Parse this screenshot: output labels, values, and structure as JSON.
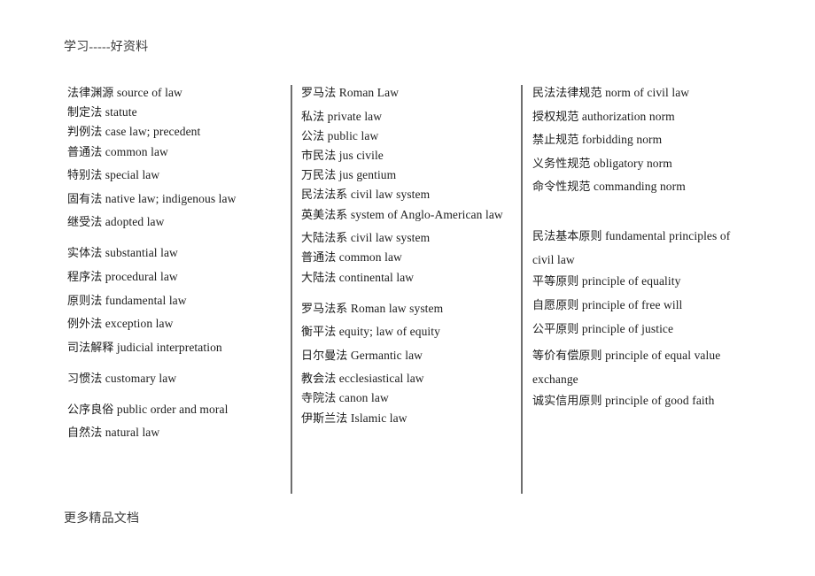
{
  "document": {
    "header": "学习-----好资料",
    "footer": "更多精品文档"
  },
  "columns": [
    {
      "id": "column-1",
      "entries": [
        {
          "cn": "法律渊源",
          "en": "source of law",
          "spacing": "tight"
        },
        {
          "cn": "制定法",
          "en": "statute",
          "spacing": "tight"
        },
        {
          "cn": "判例法",
          "en": "case law; precedent",
          "spacing": "tight"
        },
        {
          "cn": "普通法",
          "en": "common law",
          "spacing": "normal"
        },
        {
          "cn": "特别法",
          "en": "special law",
          "spacing": "normal"
        },
        {
          "cn": "固有法",
          "en": "native law; indigenous law",
          "spacing": "normal"
        },
        {
          "cn": "继受法",
          "en": "adopted law",
          "spacing": "gap"
        },
        {
          "cn": "实体法",
          "en": "substantial law",
          "spacing": "normal"
        },
        {
          "cn": "程序法",
          "en": "procedural law",
          "spacing": "normal"
        },
        {
          "cn": "原则法",
          "en": "fundamental law",
          "spacing": "normal"
        },
        {
          "cn": "例外法",
          "en": "exception law",
          "spacing": "normal"
        },
        {
          "cn": "司法解释",
          "en": "judicial interpretation",
          "spacing": "gap"
        },
        {
          "cn": "习惯法",
          "en": "customary law",
          "spacing": "gap"
        },
        {
          "cn": "公序良俗",
          "en": "public order and moral",
          "spacing": "normal"
        },
        {
          "cn": "自然法",
          "en": "natural law",
          "spacing": "normal"
        }
      ]
    },
    {
      "id": "column-2",
      "entries": [
        {
          "cn": "罗马法",
          "en": "Roman Law",
          "spacing": "normal"
        },
        {
          "cn": "私法",
          "en": "private law",
          "spacing": "tight"
        },
        {
          "cn": "公法",
          "en": "public law",
          "spacing": "tight"
        },
        {
          "cn": "市民法",
          "en": "jus civile",
          "spacing": "tight"
        },
        {
          "cn": "万民法",
          "en": "jus gentium",
          "spacing": "tight"
        },
        {
          "cn": "民法法系",
          "en": "civil law system",
          "spacing": "tight"
        },
        {
          "cn": "英美法系",
          "en": "system of Anglo-American law",
          "spacing": "normal"
        },
        {
          "cn": "大陆法系",
          "en": "civil law system",
          "spacing": "tight"
        },
        {
          "cn": "普通法",
          "en": "common law",
          "spacing": "tight"
        },
        {
          "cn": "大陆法",
          "en": "continental law",
          "spacing": "gap"
        },
        {
          "cn": "罗马法系",
          "en": "Roman law system",
          "spacing": "normal"
        },
        {
          "cn": "衡平法",
          "en": "equity; law of equity",
          "spacing": "normal"
        },
        {
          "cn": "日尔曼法",
          "en": "Germantic law",
          "spacing": "normal"
        },
        {
          "cn": "教会法",
          "en": "ecclesiastical law",
          "spacing": "tight"
        },
        {
          "cn": "寺院法",
          "en": "canon law",
          "spacing": "tight"
        },
        {
          "cn": "伊斯兰法",
          "en": "Islamic law",
          "spacing": "normal"
        }
      ]
    },
    {
      "id": "column-3",
      "entries": [
        {
          "cn": "民法法律规范",
          "en": "norm of civil law",
          "spacing": "normal"
        },
        {
          "cn": "授权规范",
          "en": "authorization norm",
          "spacing": "normal"
        },
        {
          "cn": "禁止规范",
          "en": "forbidding norm",
          "spacing": "normal"
        },
        {
          "cn": "义务性规范",
          "en": "obligatory norm",
          "spacing": "normal"
        },
        {
          "cn": "命令性规范",
          "en": "commanding norm",
          "spacing": "bigGap"
        },
        {
          "cn": "民法基本原则",
          "en": "fundamental principles of civil law",
          "spacing": "wrap"
        },
        {
          "cn": "平等原则",
          "en": "principle of equality",
          "spacing": "normal"
        },
        {
          "cn": "自愿原则",
          "en": "principle of free will",
          "spacing": "normal"
        },
        {
          "cn": "公平原则",
          "en": "principle of justice",
          "spacing": "normal"
        },
        {
          "cn": "等价有偿原则",
          "en": "principle of equal value exchange",
          "spacing": "wrap"
        },
        {
          "cn": "诚实信用原则",
          "en": "principle of good faith",
          "spacing": "normal"
        }
      ]
    }
  ],
  "style": {
    "divider_color": "#6e6e6e",
    "text_color": "#1c1c1c",
    "background": "#ffffff"
  }
}
